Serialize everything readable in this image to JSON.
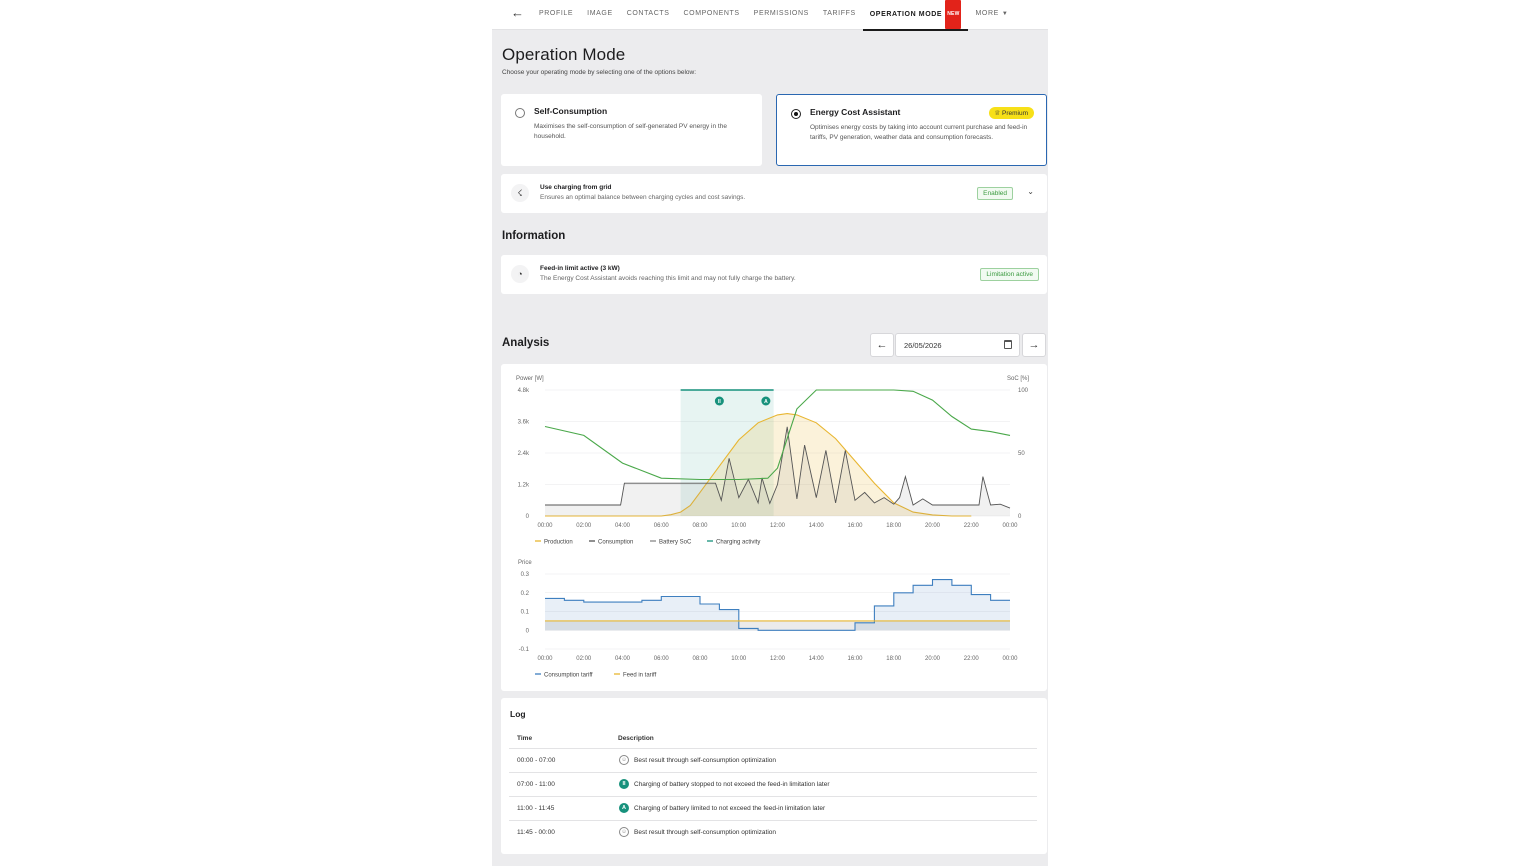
{
  "nav": {
    "tabs": [
      "PROFILE",
      "IMAGE",
      "CONTACTS",
      "COMPONENTS",
      "PERMISSIONS",
      "TARIFFS"
    ],
    "active_tab": "OPERATION MODE",
    "new_badge": "NEW",
    "more": "MORE"
  },
  "page": {
    "title": "Operation Mode",
    "subtitle": "Choose your operating mode by selecting one of the options below:"
  },
  "modes": [
    {
      "title": "Self-Consumption",
      "desc": "Maximises the self-consumption of self-generated PV energy in the household.",
      "selected": false
    },
    {
      "title": "Energy Cost Assistant",
      "desc": "Optimises energy costs by taking into account current purchase and feed-in tariffs, PV generation, weather data and consumption forecasts.",
      "selected": true,
      "badge": "Premium"
    }
  ],
  "grid_charging": {
    "title": "Use charging from grid",
    "desc": "Ensures an optimal balance between charging cycles and cost savings.",
    "status": "Enabled"
  },
  "information": {
    "heading": "Information",
    "title": "Feed-in limit active (3 kW)",
    "desc": "The Energy Cost Assistant avoids reaching this limit and may not fully charge the battery.",
    "status": "Limitation active"
  },
  "analysis": {
    "heading": "Analysis",
    "date": "26/05/2026"
  },
  "colors": {
    "production": "#e8b631",
    "consumption": "#555555",
    "soc": "#4aa84a",
    "charging": "#17917c",
    "consumption_tariff": "#3e7fbf",
    "feed_in_tariff": "#e8b631",
    "selected_border": "#2a67b1",
    "premium": "#f7e018"
  },
  "chart_data": [
    {
      "type": "line",
      "ylabel": "Power [W]",
      "y2label": "SoC [%]",
      "x": [
        "00:00",
        "02:00",
        "04:00",
        "06:00",
        "08:00",
        "10:00",
        "12:00",
        "14:00",
        "16:00",
        "18:00",
        "20:00",
        "22:00",
        "00:00"
      ],
      "yticks": [
        "0",
        "1.2k",
        "2.4k",
        "3.6k",
        "4.8k"
      ],
      "y2ticks": [
        "0",
        "50",
        "100"
      ],
      "ylim": [
        0,
        4800
      ],
      "y2lim": [
        0,
        100
      ],
      "series": [
        {
          "name": "Production",
          "x_hours": [
            0,
            5,
            6,
            6.5,
            7,
            7.5,
            8,
            9,
            10,
            11,
            12,
            12.5,
            13,
            14,
            15,
            16,
            17,
            18,
            19,
            20,
            21,
            22
          ],
          "values": [
            0,
            0,
            0,
            50,
            150,
            400,
            900,
            1900,
            2900,
            3550,
            3850,
            3900,
            3850,
            3550,
            2950,
            2100,
            1250,
            500,
            150,
            40,
            0,
            0
          ]
        },
        {
          "name": "Consumption",
          "x_hours": [
            0,
            3.9,
            4.1,
            8.8,
            9.1,
            9.5,
            10,
            10.5,
            11,
            11.2,
            11.6,
            12,
            12.5,
            13,
            13.4,
            14,
            14.5,
            15,
            15.5,
            16,
            16.5,
            17,
            17.5,
            18,
            18.3,
            18.6,
            19,
            19.5,
            20,
            21,
            22.4,
            22.6,
            23,
            23.5,
            24
          ],
          "values": [
            420,
            420,
            1250,
            1250,
            600,
            2200,
            700,
            1400,
            500,
            1450,
            480,
            1200,
            3400,
            650,
            2700,
            700,
            2500,
            500,
            2500,
            600,
            900,
            500,
            700,
            450,
            700,
            1500,
            420,
            650,
            420,
            420,
            420,
            1500,
            420,
            450,
            300
          ]
        },
        {
          "name": "Battery SoC",
          "x_hours": [
            0,
            2,
            4,
            6,
            8,
            10,
            11.5,
            12,
            13,
            14,
            15,
            16,
            17,
            18,
            19,
            20,
            21,
            22,
            23,
            24
          ],
          "values": [
            71,
            64,
            42,
            30,
            29,
            29,
            30,
            38,
            85,
            100,
            100,
            100,
            100,
            100,
            99,
            92,
            79,
            69,
            67,
            64
          ],
          "axis": "right"
        },
        {
          "name": "Charging activity",
          "x_hours": [
            7,
            11.8
          ],
          "values": [
            100,
            100
          ],
          "markers": [
            "II",
            "A"
          ]
        }
      ]
    },
    {
      "type": "line",
      "ylabel": "Price",
      "x": [
        "00:00",
        "02:00",
        "04:00",
        "06:00",
        "08:00",
        "10:00",
        "12:00",
        "14:00",
        "16:00",
        "18:00",
        "20:00",
        "22:00",
        "00:00"
      ],
      "yticks": [
        "-0.1",
        "0",
        "0.1",
        "0.2",
        "0.3"
      ],
      "ylim": [
        -0.1,
        0.3
      ],
      "series": [
        {
          "name": "Consumption tariff",
          "step": true,
          "x_hours": [
            0,
            1,
            2,
            3,
            4,
            5,
            6,
            7,
            8,
            9,
            10,
            11,
            12,
            13,
            14,
            15,
            16,
            17,
            18,
            19,
            20,
            21,
            22,
            23,
            24
          ],
          "values": [
            0.17,
            0.16,
            0.15,
            0.15,
            0.15,
            0.16,
            0.18,
            0.18,
            0.14,
            0.11,
            0.01,
            0.0,
            0.0,
            0.0,
            0.0,
            0.0,
            0.04,
            0.13,
            0.2,
            0.24,
            0.27,
            0.24,
            0.19,
            0.16,
            0.16
          ]
        },
        {
          "name": "Feed in tariff",
          "step": true,
          "x_hours": [
            0,
            24
          ],
          "values": [
            0.05,
            0.05
          ]
        }
      ]
    }
  ],
  "log": {
    "title": "Log",
    "headers": [
      "Time",
      "Description"
    ],
    "rows": [
      {
        "time": "00:00 - 07:00",
        "icon": "gray",
        "icon_text": "",
        "desc": "Best result through self-consumption optimization"
      },
      {
        "time": "07:00 - 11:00",
        "icon": "green",
        "icon_text": "II",
        "desc": "Charging of battery stopped to not exceed the feed-in limitation later"
      },
      {
        "time": "11:00 - 11:45",
        "icon": "green",
        "icon_text": "A",
        "desc": "Charging of battery limited to not exceed the feed-in limitation later"
      },
      {
        "time": "11:45 - 00:00",
        "icon": "gray",
        "icon_text": "",
        "desc": "Best result through self-consumption optimization"
      }
    ]
  }
}
